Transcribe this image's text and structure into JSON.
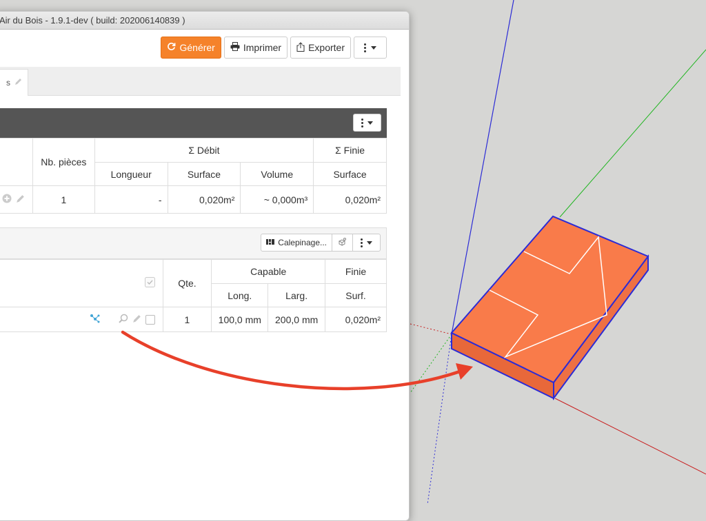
{
  "window": {
    "title": "Air du Bois - 1.9.1-dev ( build: 202006140839 )"
  },
  "toolbar": {
    "generate_label": "Générer",
    "print_label": "Imprimer",
    "export_label": "Exporter"
  },
  "tab": {
    "label": "s"
  },
  "summary_table": {
    "col_pieces": "Nb. pièces",
    "group_debit": "Σ Débit",
    "group_finie": "Σ Finie",
    "col_longueur": "Longueur",
    "col_surface": "Surface",
    "col_volume": "Volume",
    "col_finie_surface": "Surface",
    "row": {
      "pieces": "1",
      "longueur": "-",
      "surface": "0,020m²",
      "volume": "~ 0,000m³",
      "finie_surface": "0,020m²"
    }
  },
  "parts_panel": {
    "calepinage_label": "Calepinage...",
    "col_qte": "Qte.",
    "group_capable": "Capable",
    "group_finie": "Finie",
    "col_long": "Long.",
    "col_larg": "Larg.",
    "col_surf": "Surf.",
    "row": {
      "qte": "1",
      "long": "100,0 mm",
      "larg": "200,0 mm",
      "surf": "0,020m²"
    }
  },
  "colors": {
    "accent": "#f5822a",
    "model_face": "#f97b4a",
    "model_edge": "#2b2bd6",
    "annotation_arrow": "#e8402a",
    "axis_blue": "#2b2bd6",
    "axis_green": "#1fb51f",
    "axis_red": "#c81e1e"
  },
  "icons": [
    "refresh-icon",
    "print-icon",
    "export-icon",
    "kebab-menu-icon",
    "pencil-icon",
    "plus-circle-icon",
    "calepinage-icon",
    "sheet-icon",
    "hierarchy-icon",
    "zoom-icon",
    "checkbox-icon",
    "red-arrow-icon"
  ]
}
